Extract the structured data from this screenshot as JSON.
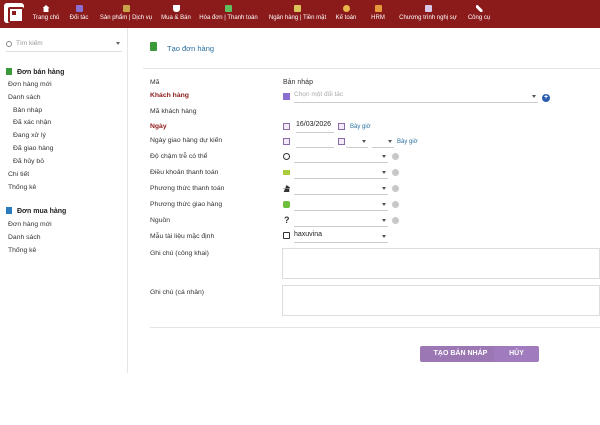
{
  "nav": {
    "items": [
      {
        "label": "Trang chủ",
        "icon": "home-icon"
      },
      {
        "label": "Đối tác",
        "icon": "partner-icon"
      },
      {
        "label": "Sản phẩm | Dịch vụ",
        "icon": "product-icon"
      },
      {
        "label": "Mua & Bán",
        "icon": "cart-icon"
      },
      {
        "label": "Hóa đơn | Thanh toán",
        "icon": "invoice-icon"
      },
      {
        "label": "Ngân hàng | Tiền mặt",
        "icon": "bank-icon"
      },
      {
        "label": "Kế toán",
        "icon": "accounting-icon"
      },
      {
        "label": "HRM",
        "icon": "hrm-icon"
      },
      {
        "label": "Chương trình nghị sự",
        "icon": "calendar-icon"
      },
      {
        "label": "Công cụ",
        "icon": "tools-icon"
      }
    ]
  },
  "sidebar": {
    "search_placeholder": "Tìm kiếm",
    "sales_title": "Đơn bán hàng",
    "sales_items": [
      "Đơn hàng mới",
      "Danh sách",
      "Bản nháp",
      "Đã xác nhận",
      "Đang xử lý",
      "Đã giao hàng",
      "Đã hủy bỏ",
      "Chi tiết",
      "Thống kê"
    ],
    "purchase_title": "Đơn mua hàng",
    "purchase_items": [
      "Đơn hàng mới",
      "Danh sách",
      "Thống kê"
    ]
  },
  "main": {
    "title": "Tạo đơn hàng",
    "labels": {
      "code": "Mã",
      "customer": "Khách hàng",
      "customer_code": "Mã khách hàng",
      "date": "Ngày",
      "expected_delivery": "Ngày giao hàng dự kiến",
      "delay": "Độ chậm trễ có thể",
      "payment_terms": "Điều khoản thanh toán",
      "payment_method": "Phương thức thanh toán",
      "shipping_method": "Phương thức giao hàng",
      "source": "Nguồn",
      "default_template": "Mẫu tài liệu mặc định",
      "public_note": "Ghi chú (công khai)",
      "private_note": "Ghi chú (cá nhân)"
    },
    "values": {
      "code": "Bản nháp",
      "customer_placeholder": "Chọn một đối tác",
      "date": "16/03/2026",
      "now_link": "Bây giờ",
      "source_icon": "?",
      "default_template": "haxuvina"
    },
    "buttons": {
      "create_draft": "TẠO BẢN NHÁP",
      "cancel": "HỦY"
    }
  }
}
